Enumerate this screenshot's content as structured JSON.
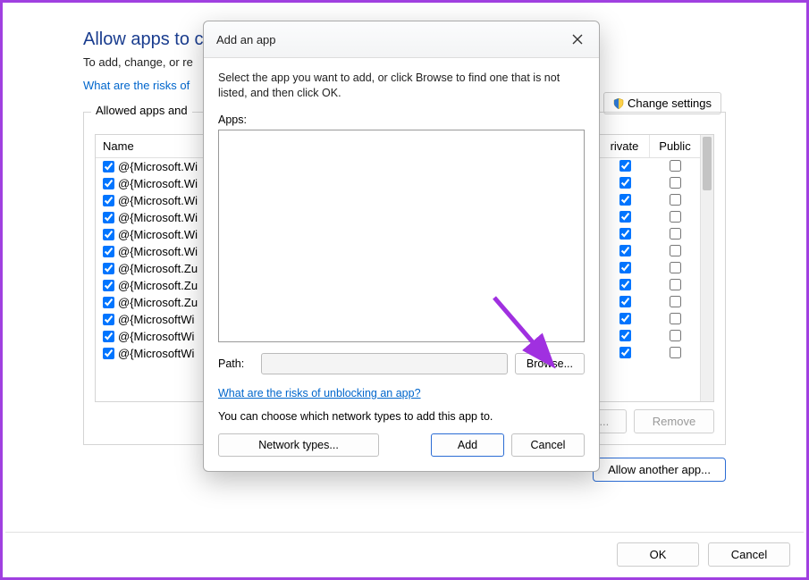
{
  "main": {
    "heading": "Allow apps to c",
    "subtext_partial": "To add, change, or re",
    "risks_link_partial": "What are the risks of",
    "change_settings_label": "Change settings",
    "group_title": "Allowed apps and",
    "columns": {
      "name": "Name",
      "private_partial": "rivate",
      "public": "Public"
    },
    "rows": [
      {
        "name": "@{Microsoft.Wi",
        "enabled": true,
        "private": true,
        "public": false
      },
      {
        "name": "@{Microsoft.Wi",
        "enabled": true,
        "private": true,
        "public": false
      },
      {
        "name": "@{Microsoft.Wi",
        "enabled": true,
        "private": true,
        "public": false
      },
      {
        "name": "@{Microsoft.Wi",
        "enabled": true,
        "private": true,
        "public": false
      },
      {
        "name": "@{Microsoft.Wi",
        "enabled": true,
        "private": true,
        "public": false
      },
      {
        "name": "@{Microsoft.Wi",
        "enabled": true,
        "private": true,
        "public": false
      },
      {
        "name": "@{Microsoft.Zu",
        "enabled": true,
        "private": true,
        "public": false
      },
      {
        "name": "@{Microsoft.Zu",
        "enabled": true,
        "private": true,
        "public": false
      },
      {
        "name": "@{Microsoft.Zu",
        "enabled": true,
        "private": true,
        "public": false
      },
      {
        "name": "@{MicrosoftWi",
        "enabled": true,
        "private": true,
        "public": false
      },
      {
        "name": "@{MicrosoftWi",
        "enabled": true,
        "private": true,
        "public": false
      },
      {
        "name": "@{MicrosoftWi",
        "enabled": true,
        "private": true,
        "public": false
      }
    ],
    "details_label": "Details...",
    "remove_label": "Remove",
    "allow_another_label": "Allow another app...",
    "ok_label": "OK",
    "cancel_label": "Cancel"
  },
  "modal": {
    "title": "Add an app",
    "instruction": "Select the app you want to add, or click Browse to find one that is not listed, and then click OK.",
    "apps_label": "Apps:",
    "path_label": "Path:",
    "path_value": "",
    "browse_label": "Browse...",
    "unblock_link": "What are the risks of unblocking an app?",
    "network_choose_text": "You can choose which network types to add this app to.",
    "network_types_label": "Network types...",
    "add_label": "Add",
    "cancel_label": "Cancel"
  }
}
